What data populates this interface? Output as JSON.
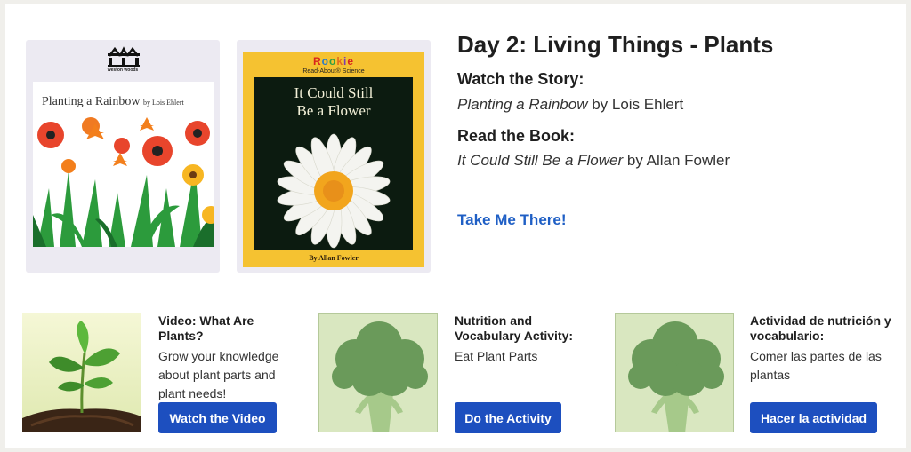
{
  "day": {
    "title": "Day 2: Living Things - Plants"
  },
  "watch": {
    "heading": "Watch the Story:",
    "book_title": "Planting a Rainbow",
    "by": "by Lois Ehlert"
  },
  "read": {
    "heading": "Read the Book:",
    "book_title": "It Could Still Be a Flower",
    "by": "by Allan Fowler"
  },
  "take_me_there": "Take Me There!",
  "covers": {
    "book1": {
      "publisher": "weston woods",
      "title": "Planting a Rainbow",
      "author": "by Lois Ehlert"
    },
    "book2": {
      "series_logo": [
        "R",
        "o",
        "o",
        "k",
        "i",
        "e"
      ],
      "series_sub": "Read-About® Science",
      "title_line1": "It Could Still",
      "title_line2": "Be a Flower",
      "author": "By Allan Fowler"
    }
  },
  "activities": [
    {
      "title": "Video: What Are Plants?",
      "description": "Grow your knowledge about plant parts and plant needs!",
      "button": "Watch the Video",
      "thumbnail": "seedling-photo"
    },
    {
      "title": "Nutrition and Vocabulary Activity:",
      "description": "Eat Plant Parts",
      "button": "Do the Activity",
      "thumbnail": "broccoli-icon"
    },
    {
      "title": "Actividad de nutrición y vocabulario:",
      "description": "Comer las partes de las plantas",
      "button": "Hacer la actividad",
      "thumbnail": "broccoli-icon"
    }
  ],
  "colors": {
    "button": "#1d4fbf",
    "link": "#1f5fc5",
    "broccoli": "#6a9a5a",
    "broccoli_bg": "#d9e7c0"
  }
}
